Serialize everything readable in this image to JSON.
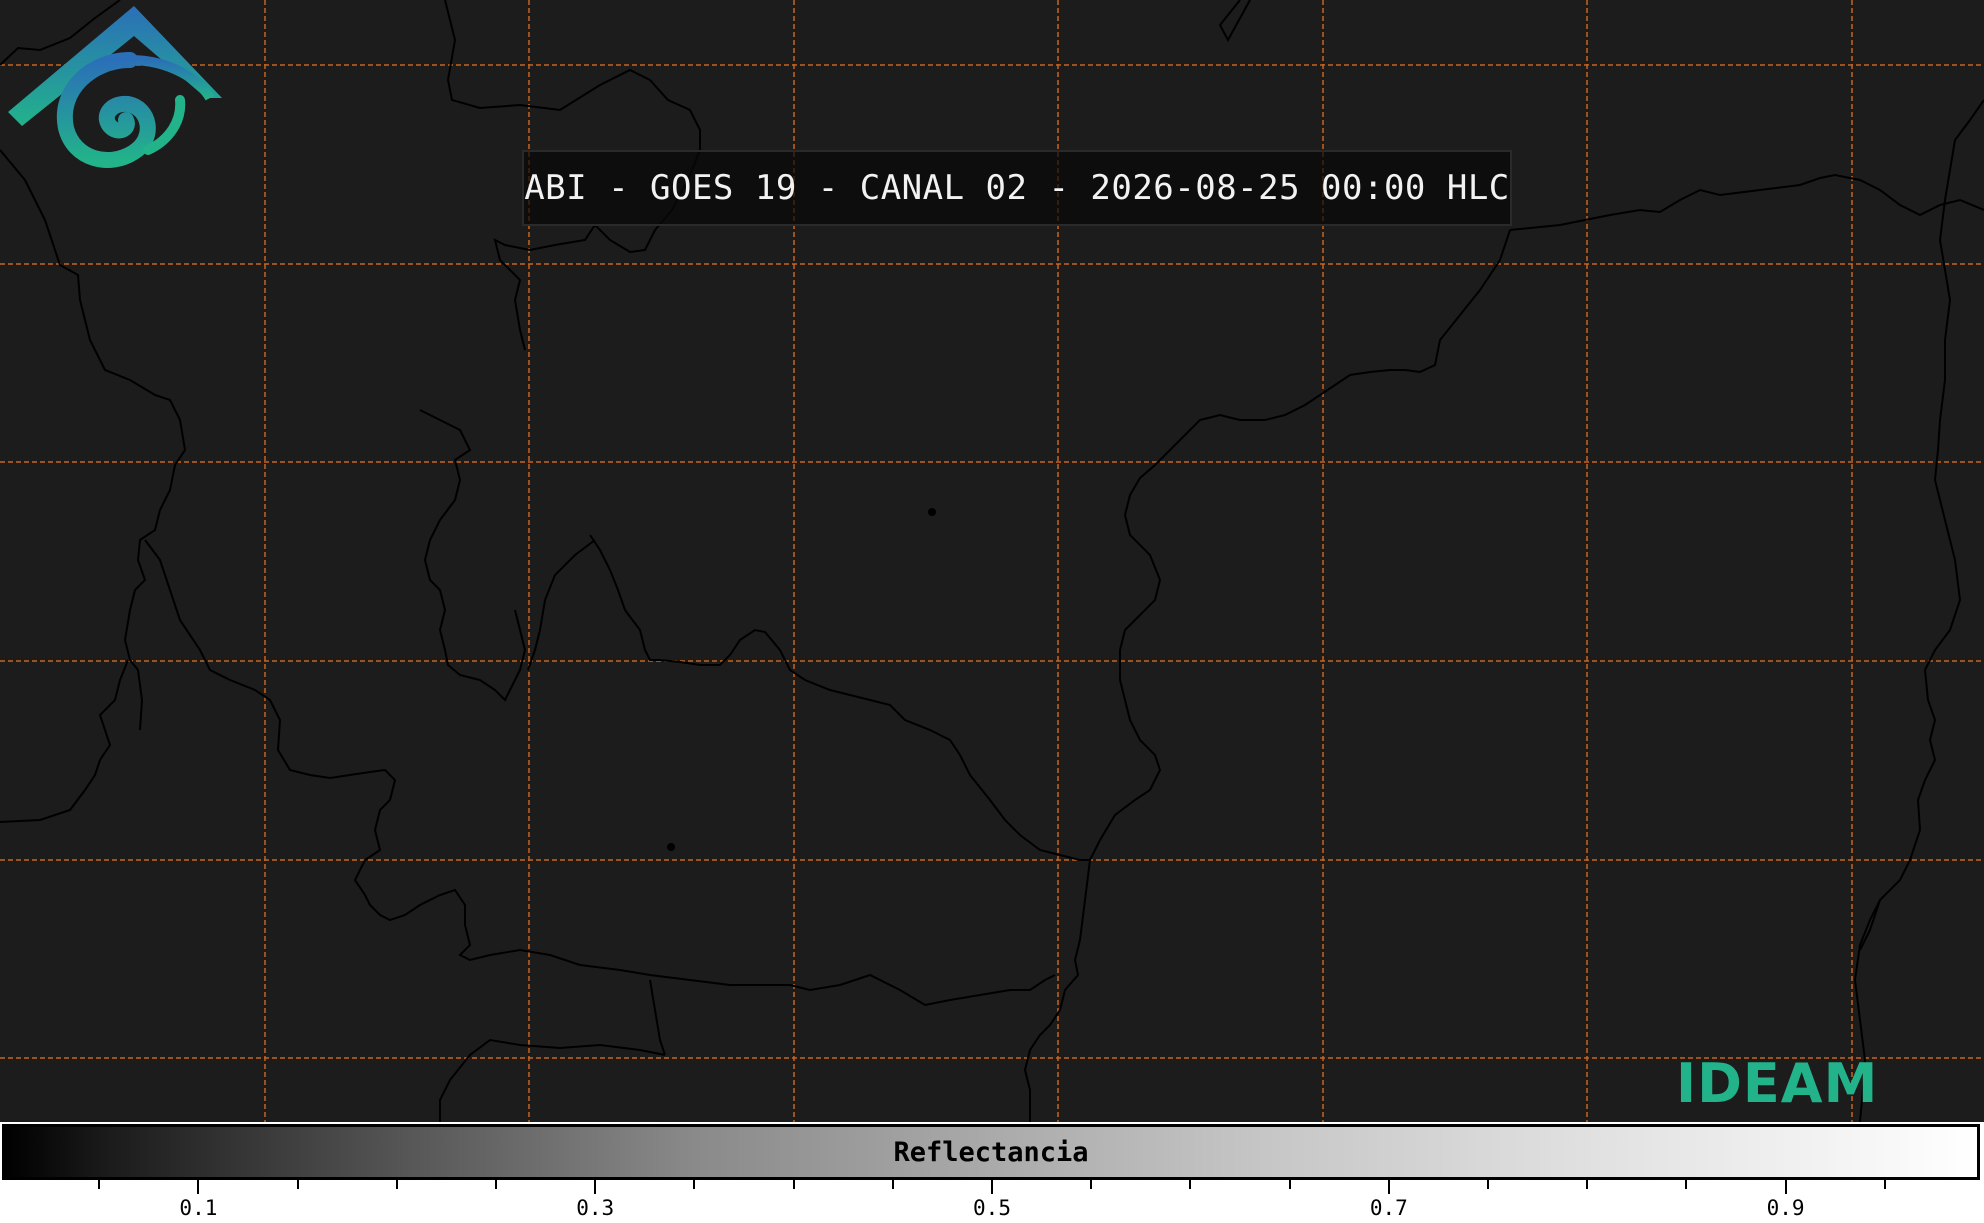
{
  "map": {
    "title": "ABI - GOES 19 - CANAL 02 - 2026-08-25 00:00 HLC",
    "background_color": "#1c1c1c",
    "grid_color": "#c8641e",
    "boundary_color": "#000000"
  },
  "logo": {
    "text": "IDEAM",
    "icon": "ideam-logo-icon",
    "colors": [
      "#2b6fb8",
      "#22b38a"
    ]
  },
  "colorbar": {
    "label": "Reflectancia",
    "range": [
      0.0,
      1.0
    ],
    "tick_values": [
      0.05,
      0.1,
      0.15,
      0.2,
      0.25,
      0.3,
      0.35,
      0.4,
      0.45,
      0.5,
      0.55,
      0.6,
      0.65,
      0.7,
      0.75,
      0.8,
      0.85,
      0.9,
      0.95
    ],
    "tick_labels": [
      {
        "value": 0.1,
        "text": "0.1"
      },
      {
        "value": 0.3,
        "text": "0.3"
      },
      {
        "value": 0.5,
        "text": "0.5"
      },
      {
        "value": 0.7,
        "text": "0.7"
      },
      {
        "value": 0.9,
        "text": "0.9"
      }
    ]
  }
}
